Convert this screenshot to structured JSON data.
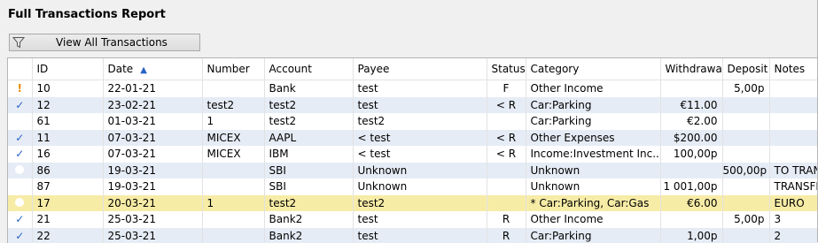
{
  "report": {
    "title": "Full Transactions Report"
  },
  "filter": {
    "label": "View All Transactions",
    "icon": "filter-icon"
  },
  "columns": [
    "",
    "ID",
    "Date",
    "Number",
    "Account",
    "Payee",
    "Status",
    "Category",
    "Withdrawal",
    "Deposit",
    "Notes"
  ],
  "sort": {
    "column": "Date",
    "direction": "ascending"
  },
  "rows": [
    {
      "flag": "warning",
      "id": "10",
      "date": "22-01-21",
      "number": "",
      "account": "Bank",
      "payee": "test",
      "status": "F",
      "category": "Other Income",
      "withdrawal": "",
      "deposit": "5,00p",
      "notes": ""
    },
    {
      "flag": "check",
      "id": "12",
      "date": "23-02-21",
      "number": "test2",
      "account": "test2",
      "payee": "test",
      "status": "< R",
      "category": "Car:Parking",
      "withdrawal": "€11.00",
      "deposit": "",
      "notes": ""
    },
    {
      "flag": "none",
      "id": "61",
      "date": "01-03-21",
      "number": "1",
      "account": "test2",
      "payee": "test2",
      "status": "",
      "category": "Car:Parking",
      "withdrawal": "€2.00",
      "deposit": "",
      "notes": ""
    },
    {
      "flag": "check",
      "id": "11",
      "date": "07-03-21",
      "number": "MICEX",
      "account": "AAPL",
      "payee": "< test",
      "status": "< R",
      "category": "Other Expenses",
      "withdrawal": "$200.00",
      "deposit": "",
      "notes": ""
    },
    {
      "flag": "check",
      "id": "16",
      "date": "07-03-21",
      "number": "MICEX",
      "account": "IBM",
      "payee": "< test",
      "status": "< R",
      "category": "Income:Investment Inc...",
      "withdrawal": "100,00p",
      "deposit": "",
      "notes": ""
    },
    {
      "flag": "none",
      "id": "86",
      "date": "19-03-21",
      "number": "",
      "account": "SBI",
      "payee": "Unknown",
      "status": "",
      "category": "Unknown",
      "withdrawal": "",
      "deposit": "500,00p",
      "notes": "TO TRAN"
    },
    {
      "flag": "none",
      "id": "87",
      "date": "19-03-21",
      "number": "",
      "account": "SBI",
      "payee": "Unknown",
      "status": "",
      "category": "Unknown",
      "withdrawal": "1 001,00p",
      "deposit": "",
      "notes": "TRANSFE"
    },
    {
      "flag": "none",
      "id": "17",
      "date": "20-03-21",
      "number": "1",
      "account": "test2",
      "payee": "test2",
      "status": "",
      "category": "* Car:Parking, Car:Gas",
      "withdrawal": "€6.00",
      "deposit": "",
      "notes": "EURO",
      "selected": true
    },
    {
      "flag": "check",
      "id": "21",
      "date": "25-03-21",
      "number": "",
      "account": "Bank2",
      "payee": "test",
      "status": "R",
      "category": "Other Income",
      "withdrawal": "",
      "deposit": "5,00p",
      "notes": "3"
    },
    {
      "flag": "check",
      "id": "22",
      "date": "25-03-21",
      "number": "",
      "account": "Bank2",
      "payee": "test",
      "status": "R",
      "category": "Car:Parking",
      "withdrawal": "1,00p",
      "deposit": "",
      "notes": "2"
    }
  ]
}
